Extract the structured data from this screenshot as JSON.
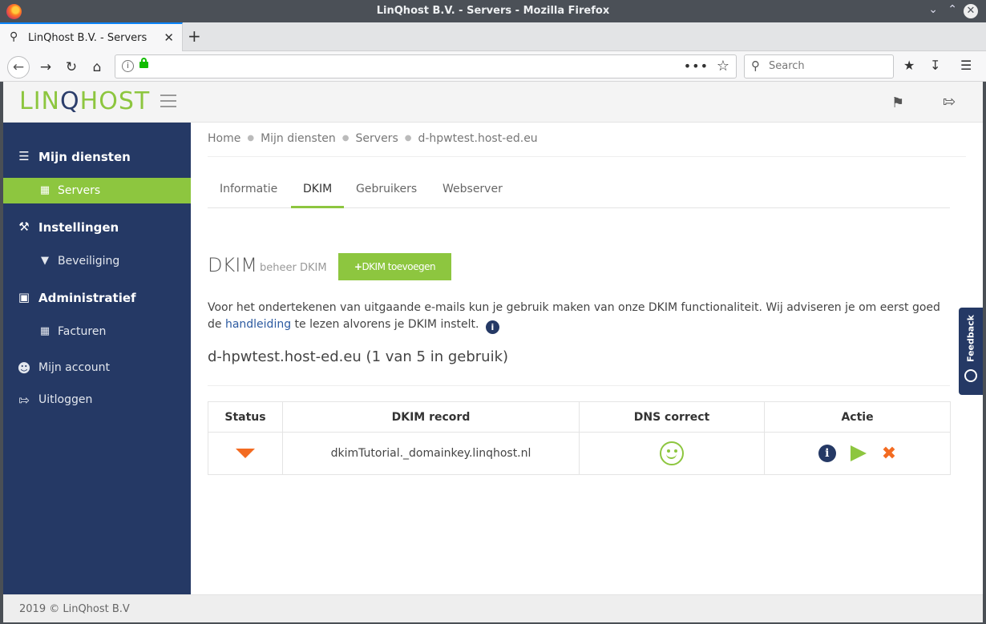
{
  "window": {
    "title": "LinQhost B.V. - Servers - Mozilla Firefox"
  },
  "browser": {
    "tab_title": "LinQhost B.V. - Servers",
    "search_placeholder": "Search"
  },
  "app": {
    "logo_text_pre": "LIN",
    "logo_text_q": "Q",
    "logo_text_post": "HOST"
  },
  "sidebar": {
    "sections": [
      {
        "label": "Mijn diensten",
        "icon": "layers-icon"
      },
      {
        "label": "Instellingen",
        "icon": "wrench-icon"
      },
      {
        "label": "Administratief",
        "icon": "money-icon"
      }
    ],
    "items": [
      {
        "label": "Servers",
        "icon": "server-list-icon",
        "active": true
      },
      {
        "label": "Beveiliging",
        "icon": "filter-icon"
      },
      {
        "label": "Facturen",
        "icon": "list-icon"
      }
    ],
    "plain": [
      {
        "label": "Mijn account",
        "icon": "user-icon"
      },
      {
        "label": "Uitloggen",
        "icon": "logout-icon"
      }
    ]
  },
  "breadcrumb": [
    "Home",
    "Mijn diensten",
    "Servers",
    "d-hpwtest.host-ed.eu"
  ],
  "tabs": [
    {
      "label": "Informatie"
    },
    {
      "label": "DKIM",
      "active": true
    },
    {
      "label": "Gebruikers"
    },
    {
      "label": "Webserver"
    }
  ],
  "heading": {
    "title": "DKIM",
    "subtitle": "beheer DKIM",
    "add_button": "DKIM toevoegen"
  },
  "description": {
    "text_before": "Voor het ondertekenen van uitgaande e-mails kun je gebruik maken van onze DKIM functionaliteit. Wij adviseren je om eerst goed de ",
    "link": "handleiding",
    "text_after": " te lezen alvorens je DKIM instelt."
  },
  "domain_title": "d-hpwtest.host-ed.eu (1 van 5 in gebruik)",
  "table": {
    "headers": [
      "Status",
      "DKIM record",
      "DNS correct",
      "Actie"
    ],
    "rows": [
      {
        "status": "collapsed",
        "record": "dkimTutorial._domainkey.linqhost.nl",
        "dns_correct": true
      }
    ]
  },
  "footer": {
    "copyright": "2019 © LinQhost B.V"
  },
  "feedback": {
    "label": "Feedback"
  },
  "colors": {
    "brand_green": "#8dc63f",
    "brand_navy": "#253965",
    "accent_orange": "#f36b21"
  }
}
